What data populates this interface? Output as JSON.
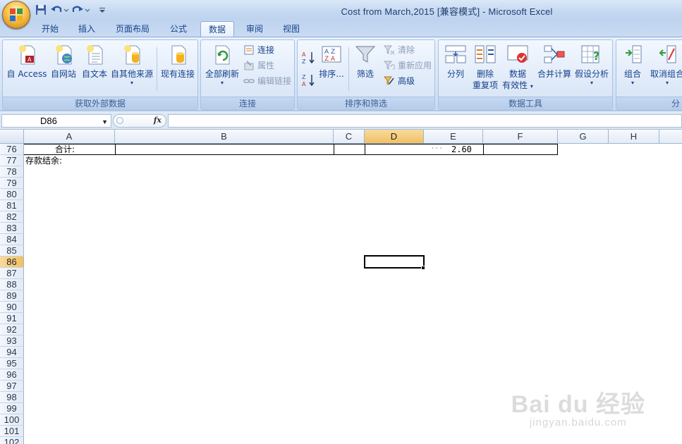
{
  "window": {
    "title": "Cost from March,2015  [兼容模式] - Microsoft Excel"
  },
  "tabs": [
    "开始",
    "插入",
    "页面布局",
    "公式",
    "数据",
    "审阅",
    "视图"
  ],
  "active_tab": "数据",
  "ribbon": {
    "groups": {
      "external": {
        "label": "获取外部数据",
        "access": "自 Access",
        "web": "自网站",
        "text": "自文本",
        "other": "自其他来源",
        "existing": "现有连接"
      },
      "connections": {
        "label": "连接",
        "refresh_all": "全部刷新",
        "connections": "连接",
        "properties": "属性",
        "edit_links": "编辑链接"
      },
      "sort_filter": {
        "label": "排序和筛选",
        "az": "A Z",
        "za": "Z A",
        "sort": "排序...",
        "filter": "筛选",
        "clear": "清除",
        "reapply": "重新应用",
        "advanced": "高级"
      },
      "data_tools": {
        "label": "数据工具",
        "text_to_columns": "分列",
        "remove_dup_1": "删除",
        "remove_dup_2": "重复项",
        "validation_1": "数据",
        "validation_2": "有效性",
        "consolidate": "合并计算",
        "what_if": "假设分析"
      },
      "outline": {
        "label": "分",
        "group": "组合",
        "ungroup": "取消组合"
      }
    }
  },
  "formula_bar": {
    "name_box": "D86",
    "fx": "fx",
    "formula": ""
  },
  "sheet": {
    "columns": [
      "A",
      "B",
      "C",
      "D",
      "E",
      "F",
      "G",
      "H"
    ],
    "selected_column": "D",
    "rows": [
      "76",
      "77",
      "78",
      "79",
      "80",
      "81",
      "82",
      "83",
      "84",
      "85",
      "86",
      "87",
      "88",
      "89",
      "90",
      "91",
      "92",
      "93",
      "94",
      "95",
      "96",
      "97",
      "98",
      "99",
      "100",
      "101",
      "102"
    ],
    "selected_row": "86",
    "cells": {
      "A76": "合计:",
      "A77": "存款结余:",
      "E76": "2.60",
      "E76_dots": "· · ·"
    }
  },
  "watermark": {
    "main": "Bai du 经验",
    "sub": "jingyan.baidu.com"
  }
}
